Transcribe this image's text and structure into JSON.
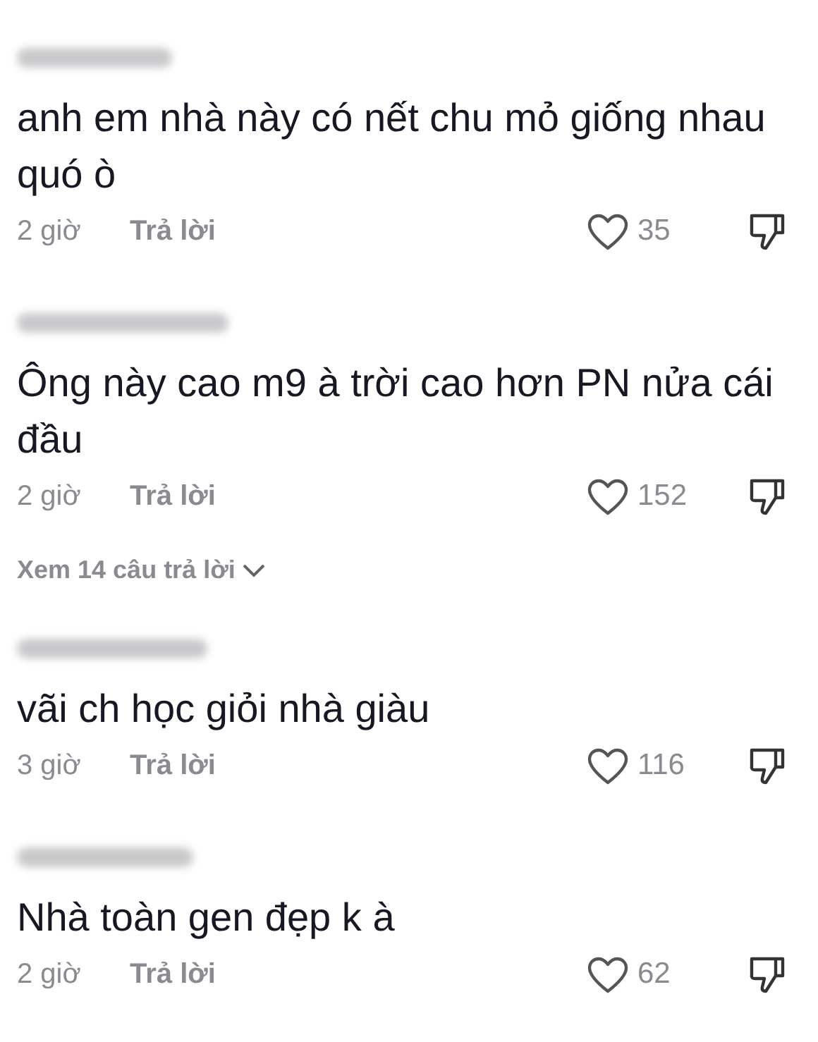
{
  "comments": [
    {
      "text": "anh em nhà này có nết chu mỏ giống nhau quó ò",
      "time": "2 giờ",
      "reply": "Trả lời",
      "likes": "35"
    },
    {
      "text": "Ông này cao m9 à trời cao hơn PN nửa cái đầu",
      "time": "2 giờ",
      "reply": "Trả lời",
      "likes": "152",
      "view_replies": "Xem 14 câu trả lời"
    },
    {
      "text": "vãi ch học giỏi nhà giàu",
      "time": "3 giờ",
      "reply": "Trả lời",
      "likes": "116"
    },
    {
      "text": "Nhà toàn gen đẹp k à",
      "time": "2 giờ",
      "reply": "Trả lời",
      "likes": "62"
    }
  ]
}
